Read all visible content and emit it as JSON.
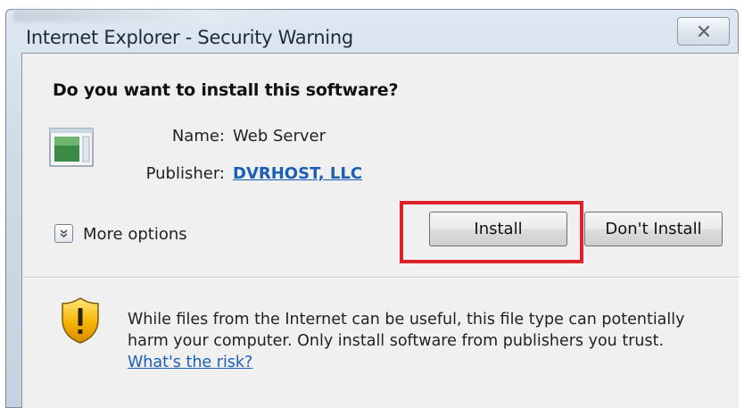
{
  "window": {
    "title": "Internet Explorer - Security Warning"
  },
  "dialog": {
    "question": "Do you want to install this software?",
    "name_label": "Name:",
    "name_value": "Web Server",
    "publisher_label": "Publisher:",
    "publisher_value": "DVRHOST, LLC",
    "more_options_label": "More options",
    "install_label": "Install",
    "dont_install_label": "Don't Install",
    "warning_text": "While files from the Internet can be useful, this file type can potentially harm your computer. Only install software from publishers you trust.",
    "risk_link": "What's the risk?"
  },
  "icons": {
    "close": "close-icon",
    "app": "application-icon",
    "expand": "chevron-down-icon",
    "warning": "warning-shield-icon"
  },
  "colors": {
    "link": "#1a5fb4",
    "highlight": "#e0202a",
    "dialog_bg": "#f0f0f0"
  }
}
